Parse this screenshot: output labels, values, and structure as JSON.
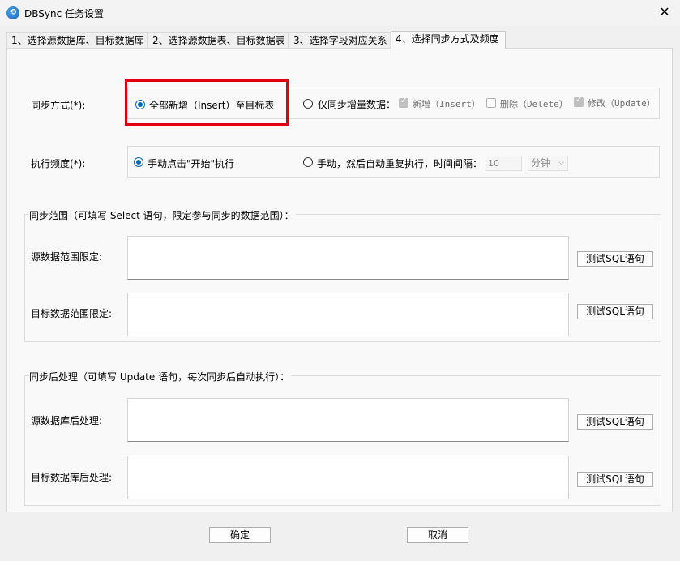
{
  "window": {
    "title": "DBSync 任务设置",
    "close_glyph": "✕"
  },
  "tabs": [
    {
      "label": "1、选择源数据库、目标数据库"
    },
    {
      "label": "2、选择源数据表、目标数据表"
    },
    {
      "label": "3、选择字段对应关系"
    },
    {
      "label": "4、选择同步方式及频度"
    }
  ],
  "sync_mode": {
    "label": "同步方式(*):",
    "option_full": "全部新增（Insert）至目标表",
    "option_incremental": "仅同步增量数据：",
    "check_insert": "新增（Insert）",
    "check_delete": "删除（Delete）",
    "check_update": "修改（Update）"
  },
  "frequency": {
    "label": "执行频度(*):",
    "option_manual": "手动点击\"开始\"执行",
    "option_auto": "手动，然后自动重复执行，时间间隔：",
    "interval_value": "10",
    "unit_value": "分钟"
  },
  "sync_range": {
    "title": "同步范围（可填写 Select 语句，限定参与同步的数据范围）：",
    "source_label": "源数据范围限定:",
    "target_label": "目标数据范围限定:",
    "test_sql": "测试SQL语句"
  },
  "post_process": {
    "title": "同步后处理（可填写 Update 语句，每次同步后自动执行）：",
    "source_label": "源数据库后处理:",
    "target_label": "目标数据库后处理:",
    "test_sql": "测试SQL语句"
  },
  "footer": {
    "ok": "确定",
    "cancel": "取消"
  }
}
